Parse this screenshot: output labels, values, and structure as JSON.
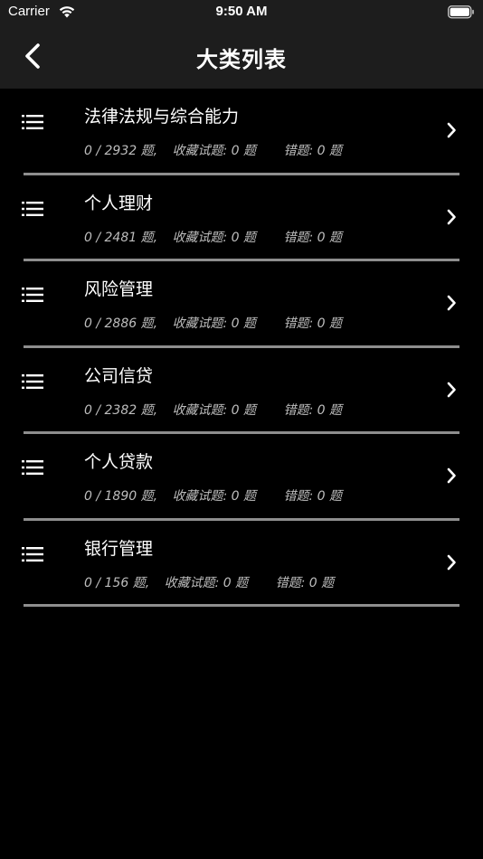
{
  "status_bar": {
    "carrier": "Carrier",
    "time": "9:50 AM"
  },
  "nav": {
    "title": "大类列表",
    "back_icon": "chevron-left-icon"
  },
  "categories": [
    {
      "title": "法律法规与综合能力",
      "progress": "0 / 2932 题,",
      "favorites": "收藏试题: 0 题",
      "errors": "错题: 0 题"
    },
    {
      "title": "个人理财",
      "progress": "0 / 2481 题,",
      "favorites": "收藏试题: 0 题",
      "errors": "错题: 0 题"
    },
    {
      "title": "风险管理",
      "progress": "0 / 2886 题,",
      "favorites": "收藏试题: 0 题",
      "errors": "错题: 0 题"
    },
    {
      "title": "公司信贷",
      "progress": "0 / 2382 题,",
      "favorites": "收藏试题: 0 题",
      "errors": "错题: 0 题"
    },
    {
      "title": "个人贷款",
      "progress": "0 / 1890 题,",
      "favorites": "收藏试题: 0 题",
      "errors": "错题: 0 题"
    },
    {
      "title": "银行管理",
      "progress": "0 / 156 题,",
      "favorites": "收藏试题: 0 题",
      "errors": "错题: 0 题"
    }
  ],
  "colors": {
    "background": "#000000",
    "header": "#1d1d1d",
    "divider": "#8e8e8e",
    "secondary_text": "#bdbdbd"
  }
}
